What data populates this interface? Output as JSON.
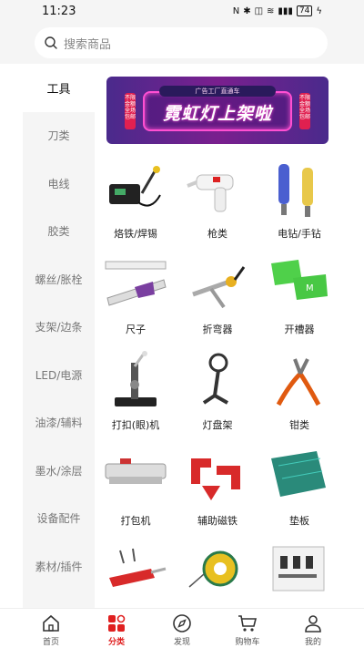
{
  "status": {
    "time": "11:23",
    "icons": [
      "nfc-icon",
      "bluetooth-icon",
      "vibrate-icon",
      "wifi-icon",
      "signal-icon"
    ],
    "battery": "74"
  },
  "search": {
    "placeholder": "搜索商品"
  },
  "sidebar": {
    "items": [
      {
        "label": "工具",
        "active": true
      },
      {
        "label": "刀类"
      },
      {
        "label": "电线"
      },
      {
        "label": "胶类"
      },
      {
        "label": "螺丝/胀栓"
      },
      {
        "label": "支架/边条"
      },
      {
        "label": "LED/电源"
      },
      {
        "label": "油漆/辅料"
      },
      {
        "label": "墨水/涂层"
      },
      {
        "label": "设备配件"
      },
      {
        "label": "素材/插件"
      }
    ]
  },
  "banner": {
    "top_text": "广告工厂直通车",
    "title": "霓虹灯上架啦",
    "tag_left": "不限金额全场包邮",
    "tag_right": "不限金额全场包邮"
  },
  "products": [
    {
      "label": "烙铁/焊锡",
      "icon": "soldering-iron-icon"
    },
    {
      "label": "枪类",
      "icon": "glue-gun-icon"
    },
    {
      "label": "电钻/手钻",
      "icon": "drill-icon"
    },
    {
      "label": "尺子",
      "icon": "ruler-icon"
    },
    {
      "label": "折弯器",
      "icon": "bender-icon"
    },
    {
      "label": "开槽器",
      "icon": "groover-icon"
    },
    {
      "label": "打扣(眼)机",
      "icon": "eyelet-machine-icon"
    },
    {
      "label": "灯盘架",
      "icon": "lamp-tray-stand-icon"
    },
    {
      "label": "钳类",
      "icon": "pliers-icon"
    },
    {
      "label": "打包机",
      "icon": "packing-machine-icon"
    },
    {
      "label": "辅助磁铁",
      "icon": "magnet-icon"
    },
    {
      "label": "垫板",
      "icon": "cutting-mat-icon"
    },
    {
      "label": "",
      "icon": "hot-knife-icon"
    },
    {
      "label": "",
      "icon": "chalk-line-icon"
    },
    {
      "label": "",
      "icon": "tool-kit-icon"
    }
  ],
  "tabbar": {
    "items": [
      {
        "label": "首页",
        "icon": "home-icon"
      },
      {
        "label": "分类",
        "icon": "category-icon",
        "active": true
      },
      {
        "label": "发现",
        "icon": "compass-icon"
      },
      {
        "label": "购物车",
        "icon": "cart-icon"
      },
      {
        "label": "我的",
        "icon": "user-icon"
      }
    ]
  },
  "colors": {
    "accent": "#e02020",
    "sidebar_bg": "#f5f5f5",
    "banner_purple": "#6a1f8e"
  }
}
